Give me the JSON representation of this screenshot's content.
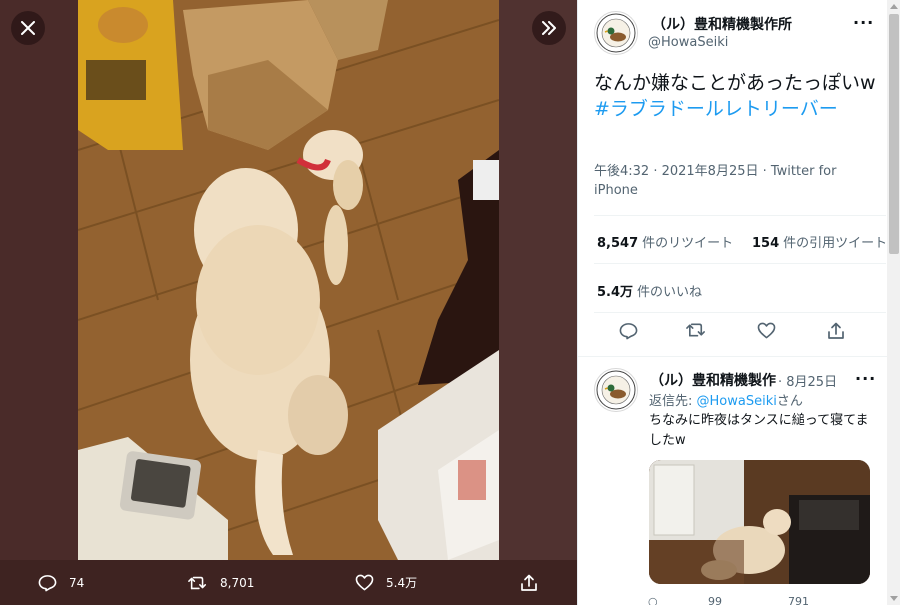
{
  "viewer": {
    "close_icon": "close-icon",
    "expand_icon": "chevron-double-right-icon",
    "actions": {
      "reply_count": "74",
      "retweet_count": "8,701",
      "like_count": "5.4万"
    }
  },
  "tweet": {
    "author_name": "（ル）豊和精機製作所",
    "author_handle": "@HowaSeiki",
    "more_label": "···",
    "text": "なんか嫌なことがあったっぽいw",
    "hashtag": "#ラブラドールレトリーバー",
    "meta": "午後4:32 · 2021年8月25日 · Twitter for iPhone",
    "retweets_value": "8,547",
    "retweets_label": "件のリツイート",
    "quotes_value": "154",
    "quotes_label": "件の引用ツイート",
    "likes_value": "5.4万",
    "likes_label": "件のいいね"
  },
  "reply": {
    "author_name": "（ル）豊和精機製作",
    "date": "· 8月25日",
    "more_label": "···",
    "reply_to_prefix": "返信先: ",
    "reply_to_mention": "@HowaSeiki",
    "reply_to_suffix": "さん",
    "text": "ちなみに昨夜はタンスに縋って寝てましたw",
    "stats": {
      "retweets": "99",
      "likes": "791"
    }
  },
  "colors": {
    "accent": "#1d9bf0",
    "viewer_bg": "#4a2a28",
    "text_primary": "#0f1419",
    "text_secondary": "#536471"
  }
}
